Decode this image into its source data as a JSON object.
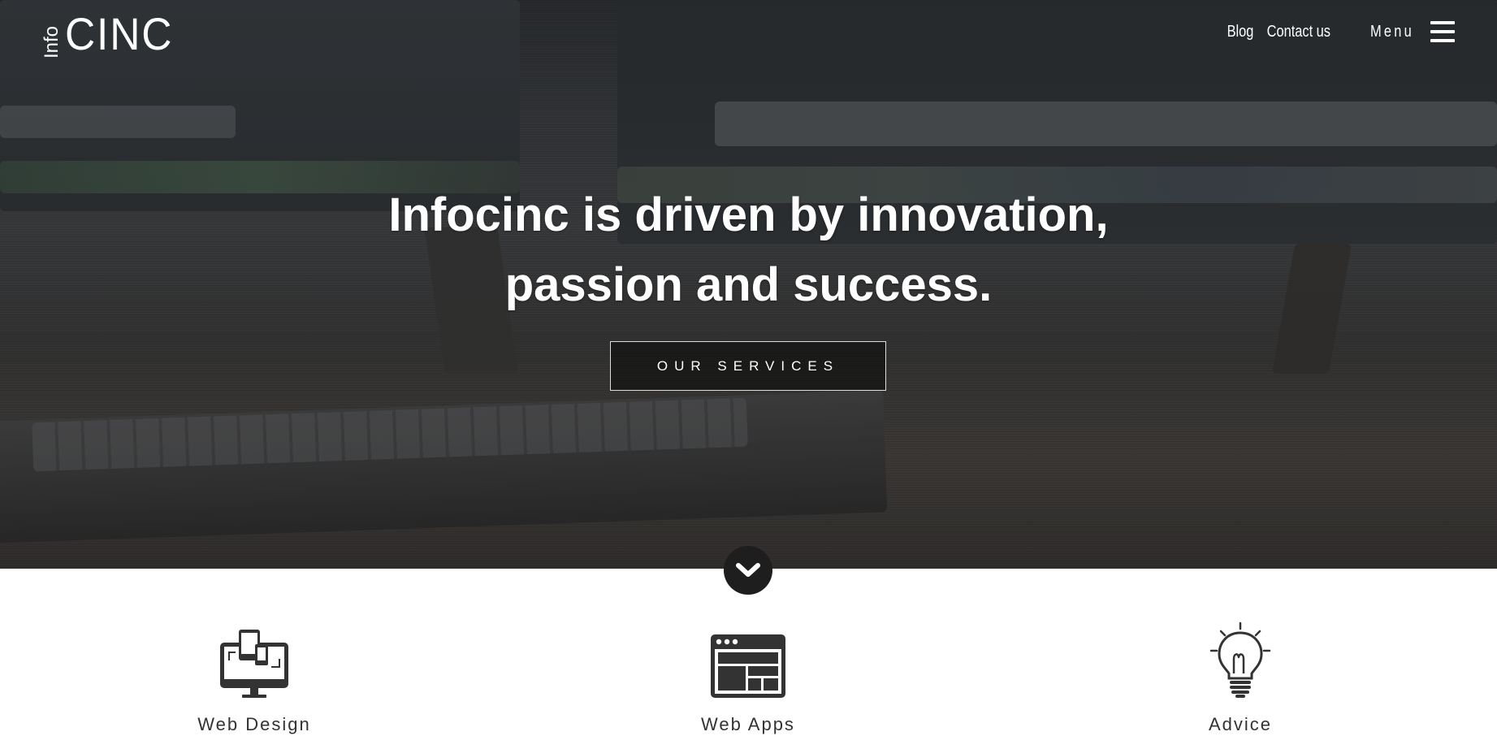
{
  "brand": {
    "logo_small": "Info",
    "logo_big": "CINC"
  },
  "nav": {
    "blog": "Blog",
    "contact": "Contact us",
    "menu": "Menu",
    "menu_icon": "hamburger-icon"
  },
  "hero": {
    "headline_line1": "Infocinc is driven by innovation,",
    "headline_line2": "passion and success.",
    "cta_label": "OUR SERVICES",
    "scroll_icon": "chevron-down-icon"
  },
  "services": [
    {
      "label": "Web Design",
      "icon": "responsive-devices-icon"
    },
    {
      "label": "Web Apps",
      "icon": "browser-layout-icon"
    },
    {
      "label": "Advice",
      "icon": "lightbulb-icon"
    }
  ],
  "colors": {
    "text_dark": "#333333",
    "white": "#ffffff",
    "circle": "#1e1e1e"
  }
}
